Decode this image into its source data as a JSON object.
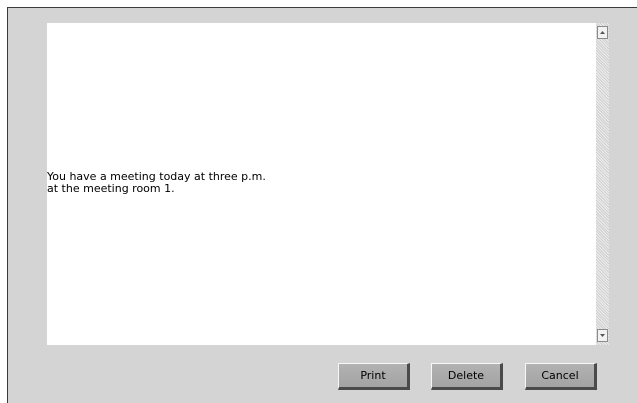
{
  "message": {
    "line1": "You have a meeting today at three p.m.",
    "line2": "at the meeting room 1."
  },
  "scrollbar": {
    "up_icon": "arrow-up-icon",
    "down_icon": "arrow-down-icon"
  },
  "actions": {
    "print_label": "Print",
    "delete_label": "Delete",
    "cancel_label": "Cancel"
  }
}
